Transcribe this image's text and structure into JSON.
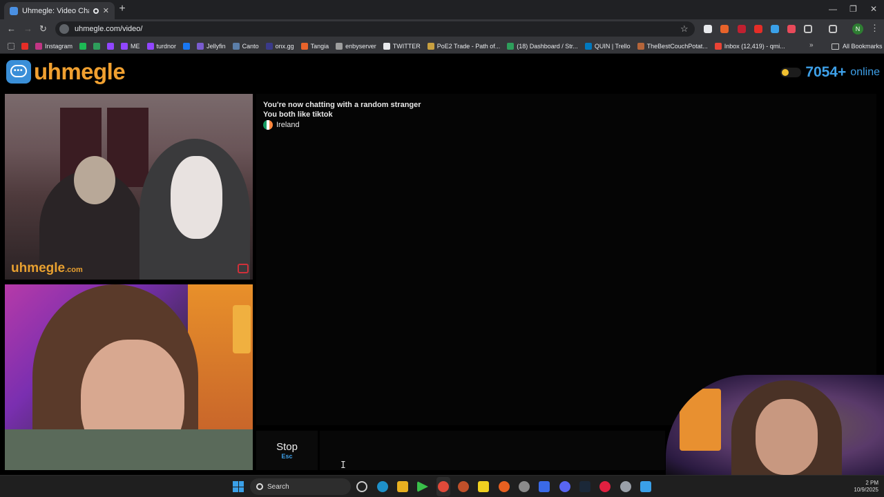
{
  "browser": {
    "tab_title": "Uhmegle: Video Chat | Ome",
    "url": "uhmegle.com/video/",
    "profile_initial": "N",
    "bookmarks": [
      {
        "label": "",
        "color": "#e52d27"
      },
      {
        "label": "Instagram",
        "color": "#c13584"
      },
      {
        "label": "",
        "color": "#1db954"
      },
      {
        "label": "",
        "color": "#2e9e5b"
      },
      {
        "label": "",
        "color": "#9146ff"
      },
      {
        "label": "ME",
        "color": "#9146ff"
      },
      {
        "label": "turdnor",
        "color": "#9146ff"
      },
      {
        "label": "",
        "color": "#1877f2"
      },
      {
        "label": "Jellyfin",
        "color": "#7a5ccf"
      },
      {
        "label": "Canto",
        "color": "#5b7ea8"
      },
      {
        "label": "onx.gg",
        "color": "#3a3a8a"
      },
      {
        "label": "Tangia",
        "color": "#e8632a"
      },
      {
        "label": "enbyserver",
        "color": "#9e9e9e"
      },
      {
        "label": "TWITTER",
        "color": "#e8eaed"
      },
      {
        "label": "PoE2 Trade - Path of...",
        "color": "#c8a040"
      },
      {
        "label": "(18) Dashboard / Str...",
        "color": "#2e9e5b"
      },
      {
        "label": "QUIN | Trello",
        "color": "#0079bf"
      },
      {
        "label": "TheBestCouchPotat...",
        "color": "#b5653a"
      },
      {
        "label": "Inbox (12,419) - qmi...",
        "color": "#ea4335"
      }
    ],
    "all_bookmarks_label": "All Bookmarks"
  },
  "site": {
    "logo_text": "uhmegle",
    "online_count": "7054+",
    "online_label": "online",
    "watermark_main": "uhmegle",
    "watermark_suffix": ".com"
  },
  "chat": {
    "lines": [
      "You're now chatting with a random stranger",
      "You both like tiktok"
    ],
    "country": "Ireland"
  },
  "controls": {
    "stop_label": "Stop",
    "stop_key": "Esc"
  },
  "taskbar": {
    "search_label": "Search",
    "time": "2 PM",
    "date": "10/9/2025"
  },
  "colors": {
    "brand_orange": "#f0a030",
    "brand_blue": "#3ea0e8"
  }
}
